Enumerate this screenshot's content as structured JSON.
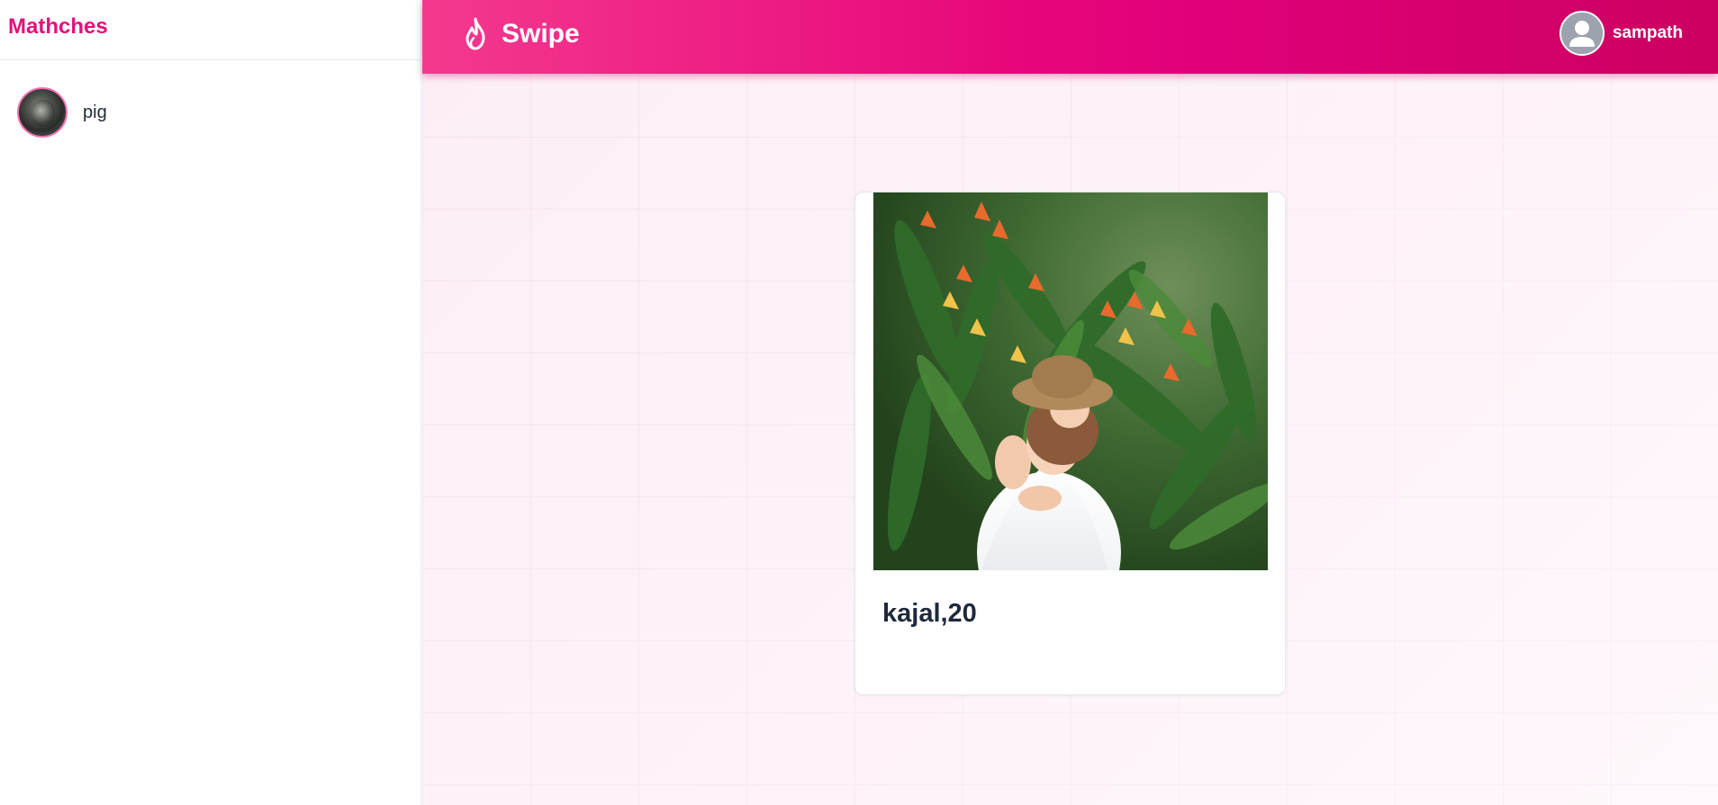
{
  "sidebar": {
    "title": "Mathches",
    "matches": [
      {
        "name": "pig",
        "avatar_icon": "profile-photo"
      }
    ]
  },
  "topbar": {
    "brand": "Swipe",
    "brand_icon": "flame-icon",
    "user": {
      "name": "sampath",
      "avatar_icon": "default-user-icon"
    }
  },
  "card": {
    "title": "kajal,20",
    "photo": "profile-photo"
  },
  "colors": {
    "accent": "#e0127a",
    "topbar_start": "#f4398f",
    "topbar_end": "#cc0060",
    "background": "#fdeef6"
  }
}
